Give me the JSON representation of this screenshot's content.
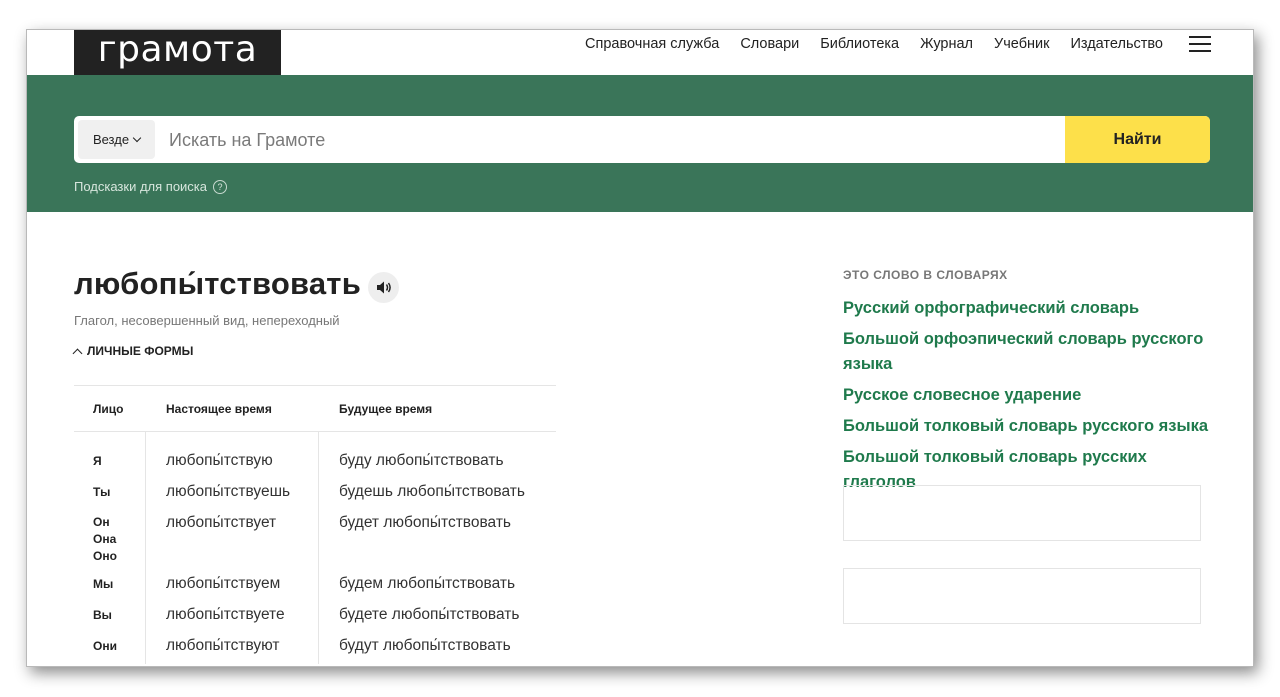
{
  "site": {
    "logo": "грамота",
    "nav": [
      "Справочная служба",
      "Словари",
      "Библиотека",
      "Журнал",
      "Учебник",
      "Издательство"
    ]
  },
  "search": {
    "scope": "Везде",
    "placeholder": "Искать на Грамоте",
    "button": "Найти",
    "hints": "Подсказки для поиска",
    "hints_icon": "?"
  },
  "entry": {
    "word": "любопы́тствовать",
    "pos": "Глагол, несовершенный вид, непереходный",
    "forms_label": "ЛИЧНЫЕ ФОРМЫ",
    "table": {
      "headers": [
        "Лицо",
        "Настоящее время",
        "Будущее время"
      ],
      "rows": [
        {
          "person": "Я",
          "present": "любопы́тствую",
          "future": "буду любопы́тствовать"
        },
        {
          "person": "Ты",
          "present": "любопы́тствуешь",
          "future": "будешь любопы́тствовать"
        },
        {
          "person": "Он\nОна\nОно",
          "present": "любопы́тствует",
          "future": "будет любопы́тствовать"
        },
        {
          "person": "Мы",
          "present": "любопы́тствуем",
          "future": "будем любопы́тствовать"
        },
        {
          "person": "Вы",
          "present": "любопы́тствуете",
          "future": "будете любопы́тствовать"
        },
        {
          "person": "Они",
          "present": "любопы́тствуют",
          "future": "будут любопы́тствовать"
        }
      ]
    }
  },
  "sidebar": {
    "title": "ЭТО СЛОВО В СЛОВАРЯХ",
    "dictionaries": [
      "Русский орфографический словарь",
      "Большой орфоэпический словарь русского языка",
      "Русское словесное ударение",
      "Большой толковый словарь русского языка",
      "Большой толковый словарь русских глаголов"
    ]
  },
  "colors": {
    "brand_green": "#3a7559",
    "button_yellow": "#fde04a",
    "link_green": "#1f7a4c"
  },
  "icons": [
    "menu-icon",
    "chevron-down-icon",
    "question-icon",
    "speaker-icon",
    "chevron-up-icon"
  ]
}
